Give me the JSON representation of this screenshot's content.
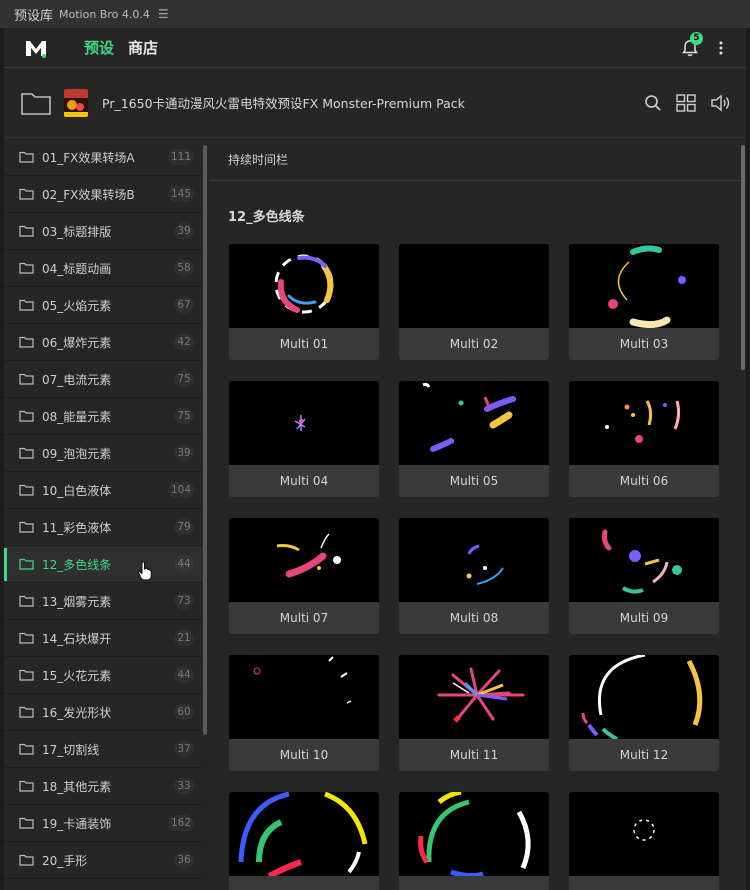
{
  "window": {
    "title": "预设库",
    "app_name": "Motion Bro 4.0.4",
    "menu_icon": "hamburger-icon"
  },
  "header": {
    "logo_icon": "motionbro-logo-icon",
    "tabs": [
      {
        "label": "预设",
        "active": true
      },
      {
        "label": "商店",
        "active": false
      }
    ],
    "notification_count": "5",
    "accent_color": "#3ddc84"
  },
  "pack": {
    "title": "Pr_1650卡通动漫风火雷电特效预设FX Monster-Premium Pack"
  },
  "categories": [
    {
      "label": "01_FX效果转场A",
      "count": "111"
    },
    {
      "label": "02_FX效果转场B",
      "count": "145"
    },
    {
      "label": "03_标题排版",
      "count": "39"
    },
    {
      "label": "04_标题动画",
      "count": "58"
    },
    {
      "label": "05_火焰元素",
      "count": "67"
    },
    {
      "label": "06_爆炸元素",
      "count": "42"
    },
    {
      "label": "07_电流元素",
      "count": "75"
    },
    {
      "label": "08_能量元素",
      "count": "75"
    },
    {
      "label": "09_泡泡元素",
      "count": "39"
    },
    {
      "label": "10_白色液体",
      "count": "104"
    },
    {
      "label": "11_彩色液体",
      "count": "79"
    },
    {
      "label": "12_多色线条",
      "count": "44",
      "active": true
    },
    {
      "label": "13_烟雾元素",
      "count": "73"
    },
    {
      "label": "14_石块爆开",
      "count": "21"
    },
    {
      "label": "15_火花元素",
      "count": "44"
    },
    {
      "label": "16_发光形状",
      "count": "60"
    },
    {
      "label": "17_切割线",
      "count": "37"
    },
    {
      "label": "18_其他元素",
      "count": "33"
    },
    {
      "label": "19_卡通装饰",
      "count": "162"
    },
    {
      "label": "20_手形",
      "count": "36"
    }
  ],
  "main": {
    "subtab": "持续时间栏",
    "section_title": "12_多色线条",
    "presets": [
      {
        "label": "Multi 01"
      },
      {
        "label": "Multi 02"
      },
      {
        "label": "Multi 03"
      },
      {
        "label": "Multi 04"
      },
      {
        "label": "Multi 05"
      },
      {
        "label": "Multi 06"
      },
      {
        "label": "Multi 07"
      },
      {
        "label": "Multi 08"
      },
      {
        "label": "Multi 09"
      },
      {
        "label": "Multi 10"
      },
      {
        "label": "Multi 11"
      },
      {
        "label": "Multi 12"
      },
      {
        "label": ""
      },
      {
        "label": ""
      },
      {
        "label": ""
      }
    ]
  }
}
